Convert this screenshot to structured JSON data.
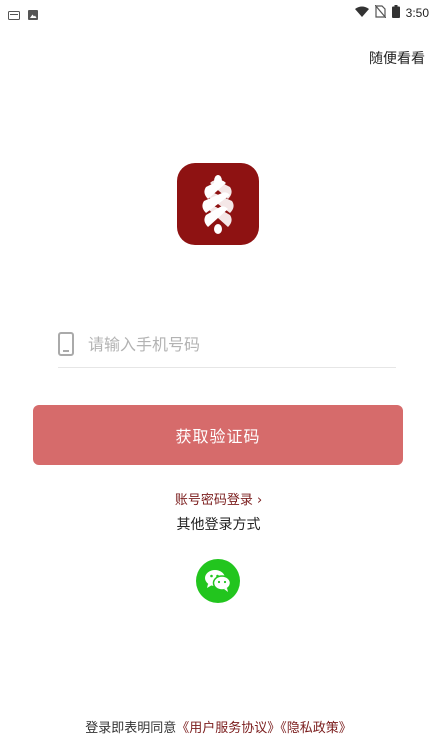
{
  "status_bar": {
    "time": "3:50",
    "icons": [
      "notification-icon",
      "image-icon",
      "wifi-icon",
      "no-sim-icon",
      "battery-icon"
    ]
  },
  "header": {
    "skip_label": "随便看看"
  },
  "logo": {
    "icon": "braid-logo-icon",
    "color": "#8e1212"
  },
  "phone_field": {
    "value": "",
    "placeholder": "请输入手机号码",
    "icon": "phone-icon"
  },
  "primary_button": {
    "label": "获取验证码",
    "color": "#d66b6b"
  },
  "account_login": {
    "label": "账号密码登录 ›"
  },
  "other_methods": {
    "label": "其他登录方式"
  },
  "wechat": {
    "icon": "wechat-icon",
    "color": "#22c51e"
  },
  "agreement": {
    "prefix": "登录即表明同意",
    "user_agreement": "《用户服务协议》",
    "privacy_policy": "《隐私政策》"
  }
}
